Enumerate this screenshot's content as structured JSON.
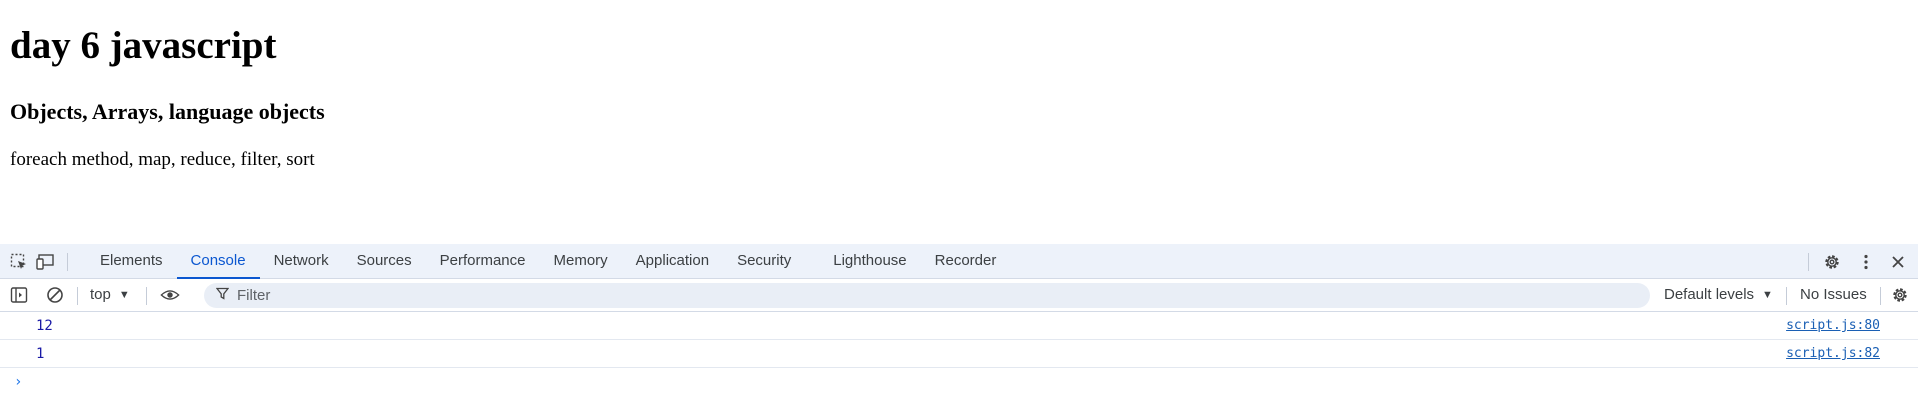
{
  "page": {
    "heading": "day 6 javascript",
    "subheading": "Objects, Arrays, language objects",
    "paragraph": "foreach method, map, reduce, filter, sort"
  },
  "devtools": {
    "tabs": [
      {
        "label": "Elements"
      },
      {
        "label": "Console",
        "active": true
      },
      {
        "label": "Network"
      },
      {
        "label": "Sources"
      },
      {
        "label": "Performance"
      },
      {
        "label": "Memory"
      },
      {
        "label": "Application"
      },
      {
        "label": "Security"
      },
      {
        "label": "Lighthouse"
      },
      {
        "label": "Recorder"
      }
    ],
    "toolbar": {
      "context": "top",
      "filter_placeholder": "Filter",
      "levels": "Default levels",
      "issues": "No Issues"
    },
    "console": {
      "messages": [
        {
          "value": "12",
          "source": "script.js:80"
        },
        {
          "value": "1",
          "source": "script.js:82"
        }
      ],
      "prompt": "›"
    },
    "icons": {
      "inspect": "inspect-element-icon",
      "device": "device-toolbar-icon",
      "settings": "settings-gear-icon",
      "more": "more-vert-icon",
      "close": "close-icon",
      "sidebar": "show-sidebar-icon",
      "clear": "clear-console-icon",
      "eye": "live-expression-eye-icon",
      "filter": "filter-funnel-icon",
      "console_settings": "console-settings-gear-icon"
    },
    "colors": {
      "tabbar_bg": "#edf2fa",
      "accent": "#0b57d0",
      "value_text": "#1a1aa6",
      "link": "#1a5fb4"
    }
  }
}
